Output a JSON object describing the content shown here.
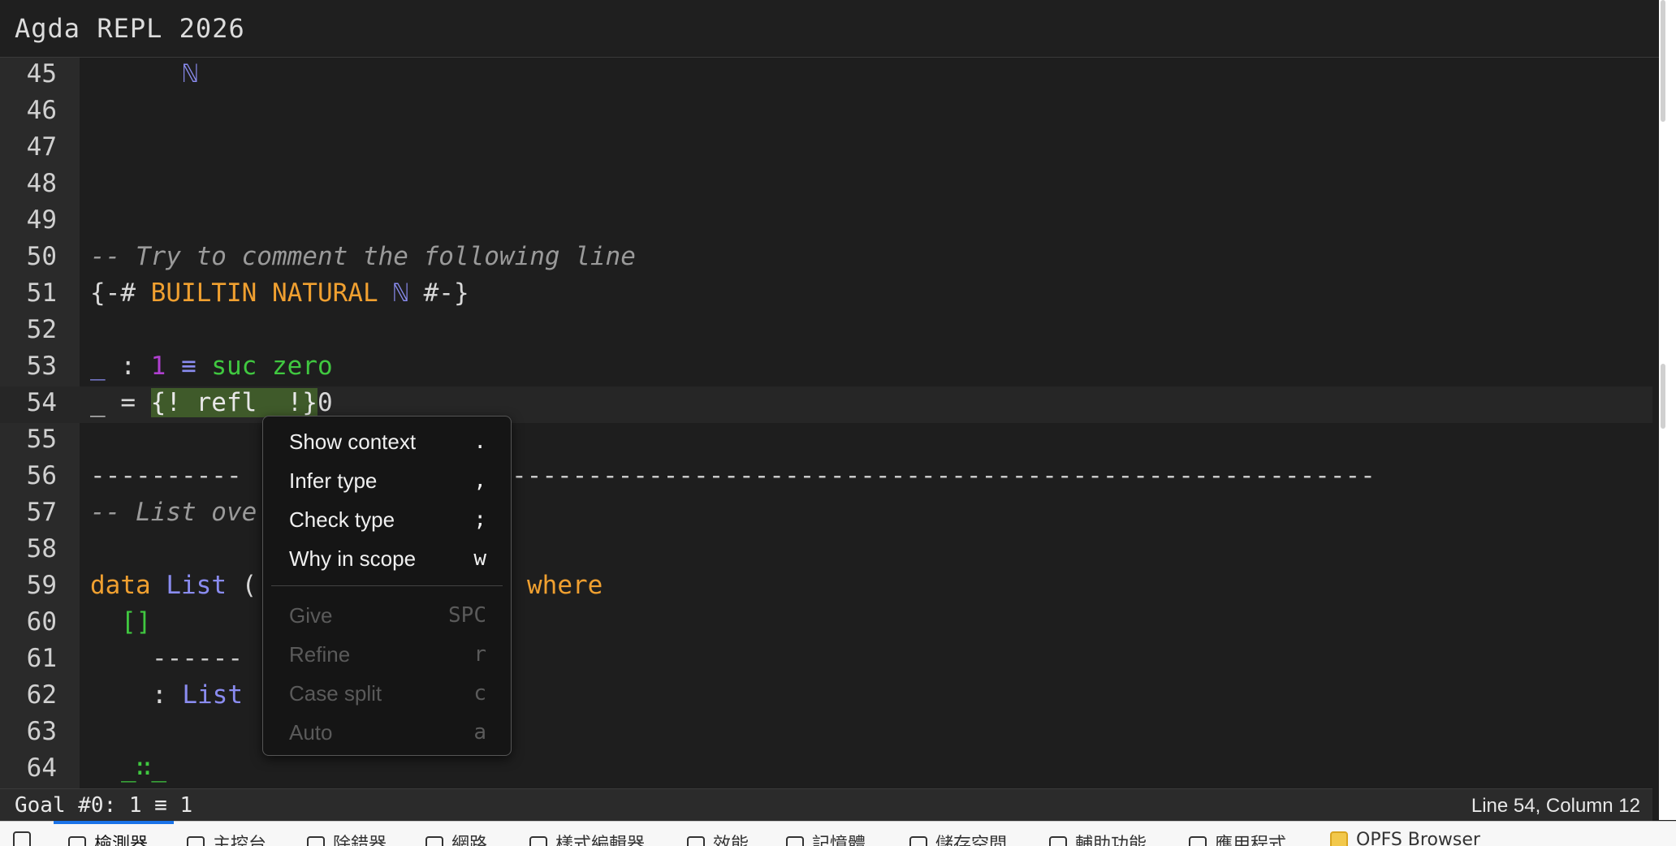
{
  "window": {
    "title": "Agda REPL 2026"
  },
  "editor": {
    "lines": {
      "l45": "45",
      "l46": "46",
      "l47": "47",
      "l48": "48",
      "l49": "49",
      "l50": "50",
      "l51": "51",
      "l52": "52",
      "l53": "53",
      "l54": "54",
      "l55": "55",
      "l56": "56",
      "l57": "57",
      "l58": "58",
      "l59": "59",
      "l60": "60",
      "l61": "61",
      "l62": "62",
      "l63": "63",
      "l64": "64"
    },
    "code": {
      "c45": "ℕ",
      "c50": "-- Try to comment the following line",
      "c51_open": "{-# ",
      "c51_pragma": "BUILTIN NATURAL",
      "c51_nat": "ℕ",
      "c51_close": " #-}",
      "c53_under": "_",
      "c53_colon": " : ",
      "c53_one": "1",
      "c53_eq": " ≡ ",
      "c53_suc": "suc",
      "c53_zero": "zero",
      "c54_lhs": "_ = ",
      "c54_goal": "{! refl  !}",
      "c54_goalno": "0",
      "c56_a": "----------",
      "c56_b": "---------------------------------------------------------",
      "c57": "-- List ove",
      "c59_data": "data",
      "c59_list": "List",
      "c59_paren": " (",
      "c59_where": "where",
      "c60": "[]",
      "c61": "------",
      "c62_colon": ": ",
      "c62_list": "List",
      "c64": "_∷_"
    }
  },
  "context_menu": {
    "items": [
      {
        "label": "Show context",
        "key": "."
      },
      {
        "label": "Infer type",
        "key": ","
      },
      {
        "label": "Check type",
        "key": ";"
      },
      {
        "label": "Why in scope",
        "key": "w"
      },
      {
        "label": "Give",
        "key": "SPC"
      },
      {
        "label": "Refine",
        "key": "r"
      },
      {
        "label": "Case split",
        "key": "c"
      },
      {
        "label": "Auto",
        "key": "a"
      }
    ]
  },
  "status": {
    "goal": "Goal #0: 1 ≡ 1",
    "position": "Line 54, Column 12"
  },
  "devtools": {
    "tabs": [
      {
        "label": "檢測器",
        "icon": "inspector-icon"
      },
      {
        "label": "主控台",
        "icon": "console-icon"
      },
      {
        "label": "除錯器",
        "icon": "debugger-icon"
      },
      {
        "label": "網路",
        "icon": "network-icon"
      },
      {
        "label": "樣式編輯器",
        "icon": "style-editor-icon"
      },
      {
        "label": "效能",
        "icon": "performance-icon"
      },
      {
        "label": "記憶體",
        "icon": "memory-icon"
      },
      {
        "label": "儲存空間",
        "icon": "storage-icon"
      },
      {
        "label": "輔助功能",
        "icon": "accessibility-icon"
      },
      {
        "label": "應用程式",
        "icon": "application-icon"
      },
      {
        "label": "OPFS Browser",
        "icon": "folder-icon"
      }
    ]
  },
  "colors": {
    "background": "#1e1e1e",
    "gutter": "#2a2a2a",
    "keyword": "#f0a030",
    "type": "#8a8cf0",
    "constructor": "#40c840",
    "number": "#b040d0",
    "goal_highlight": "#3f5a2a",
    "accent": "#1a73e8"
  }
}
